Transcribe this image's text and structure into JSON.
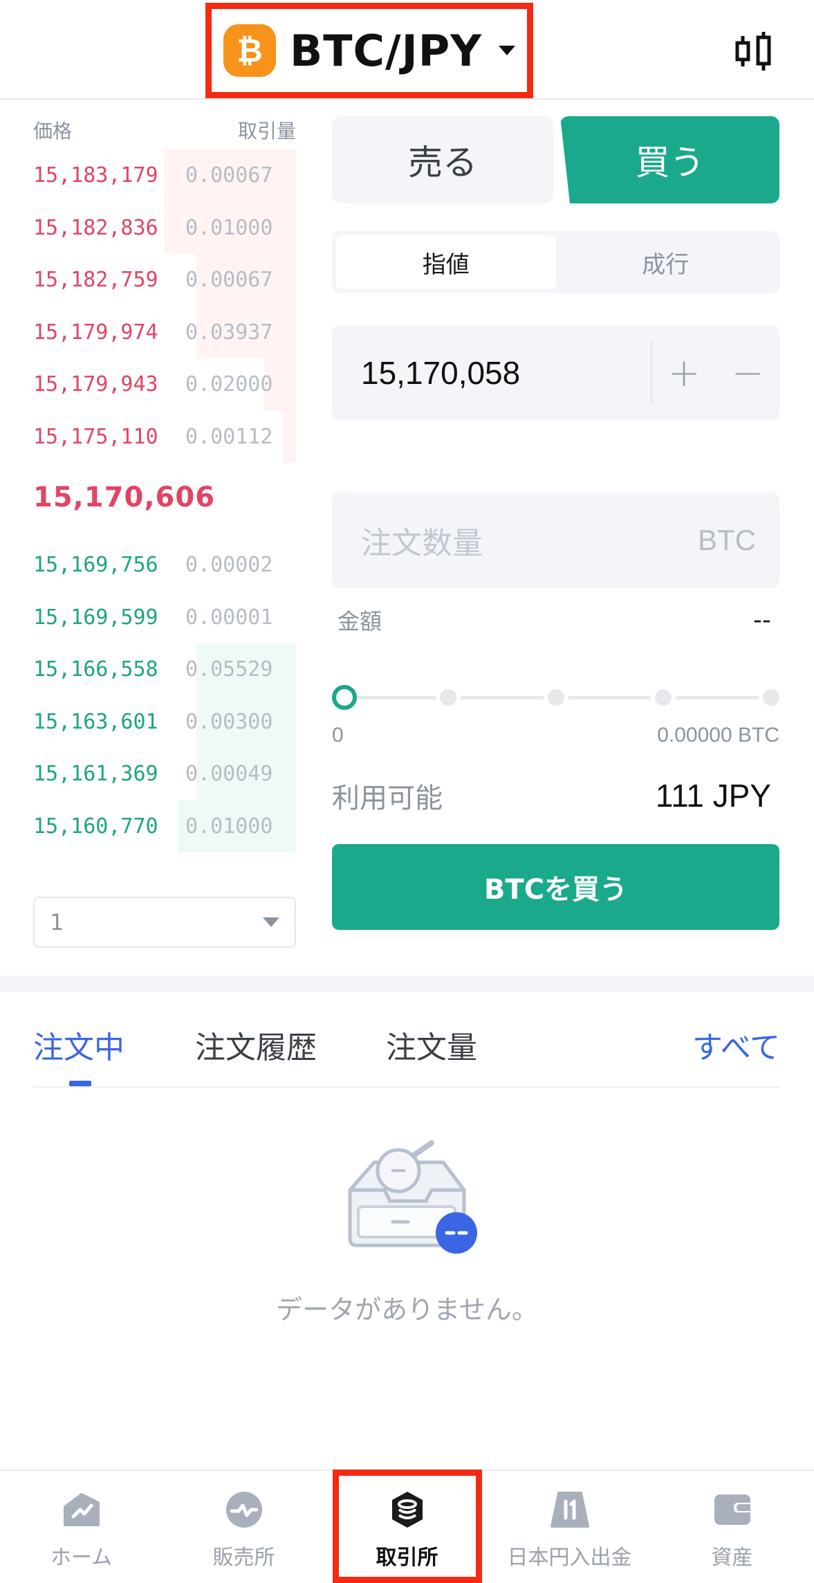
{
  "header": {
    "pair": "BTC/JPY",
    "coin_symbol": "₿"
  },
  "orderbook": {
    "col_price": "価格",
    "col_qty": "取引量",
    "asks": [
      {
        "price": "15,183,179",
        "qty": "0.00067",
        "depth": 0.5
      },
      {
        "price": "15,182,836",
        "qty": "0.01000",
        "depth": 0.5
      },
      {
        "price": "15,182,759",
        "qty": "0.00067",
        "depth": 0.38
      },
      {
        "price": "15,179,974",
        "qty": "0.03937",
        "depth": 0.38
      },
      {
        "price": "15,179,943",
        "qty": "0.02000",
        "depth": 0.12
      },
      {
        "price": "15,175,110",
        "qty": "0.00112",
        "depth": 0.05
      }
    ],
    "mid_price": "15,170,606",
    "bids": [
      {
        "price": "15,169,756",
        "qty": "0.00002",
        "depth": 0.0
      },
      {
        "price": "15,169,599",
        "qty": "0.00001",
        "depth": 0.0
      },
      {
        "price": "15,166,558",
        "qty": "0.05529",
        "depth": 0.38
      },
      {
        "price": "15,163,601",
        "qty": "0.00300",
        "depth": 0.38
      },
      {
        "price": "15,161,369",
        "qty": "0.00049",
        "depth": 0.38
      },
      {
        "price": "15,160,770",
        "qty": "0.01000",
        "depth": 0.45
      }
    ],
    "depth_select_value": "1"
  },
  "form": {
    "sell_label": "売る",
    "buy_label": "買う",
    "limit_label": "指値",
    "market_label": "成行",
    "price_value": "15,170,058",
    "plus": "+",
    "minus": "−",
    "qty_placeholder": "注文数量",
    "qty_unit": "BTC",
    "amount_label": "金額",
    "amount_value": "--",
    "slider_min": "0",
    "slider_max": "0.00000 BTC",
    "slider_value": 0,
    "available_label": "利用可能",
    "available_value": "111 JPY",
    "submit_label": "BTCを買う"
  },
  "orders": {
    "tabs": [
      "注文中",
      "注文履歴",
      "注文量"
    ],
    "see_all": "すべて",
    "empty_text": "データがありません。"
  },
  "nav": {
    "items": [
      {
        "label": "ホーム",
        "icon": "home-chart-icon"
      },
      {
        "label": "販売所",
        "icon": "exchange-wave-icon"
      },
      {
        "label": "取引所",
        "icon": "coin-stack-icon"
      },
      {
        "label": "日本円入出金",
        "icon": "deposit-withdraw-icon"
      },
      {
        "label": "資産",
        "icon": "wallet-icon"
      }
    ],
    "active_index": 2
  },
  "colors": {
    "ask": "#e24466",
    "bid": "#1ea483",
    "buy_green": "#1aa98a",
    "accent_blue": "#3a66e4",
    "highlight_red": "#f42a12",
    "btc_orange": "#f7931a"
  }
}
